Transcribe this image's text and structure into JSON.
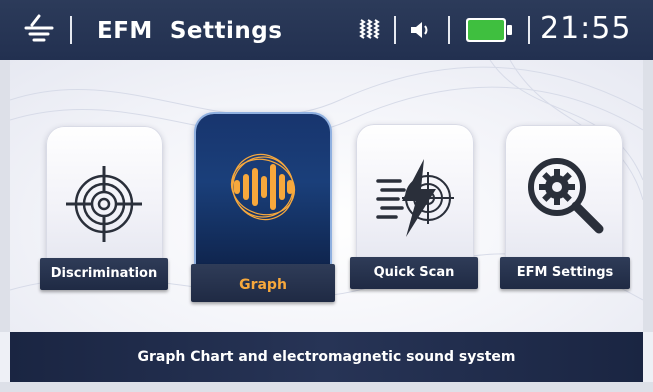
{
  "header": {
    "title": "EFM  Settings",
    "time": "21:55",
    "icons": [
      "ground-icon",
      "signal-icon",
      "volume-icon",
      "battery-icon"
    ],
    "battery_color": "#3fbf3f"
  },
  "menu": {
    "items": [
      {
        "label": "Discrimination",
        "icon": "crosshair-target-icon",
        "active": false
      },
      {
        "label": "Graph",
        "icon": "waveform-icon",
        "active": true
      },
      {
        "label": "Quick Scan",
        "icon": "lightning-scan-icon",
        "active": false
      },
      {
        "label": "EFM  Settings",
        "icon": "gear-magnifier-icon",
        "active": false
      }
    ]
  },
  "footer": {
    "description": "Graph Chart and electromagnetic sound system"
  },
  "colors": {
    "header_bg": "#253454",
    "active_card": "#1a3f7a",
    "active_label_text": "#f7a83c",
    "footer_bg": "#1f2a48"
  }
}
